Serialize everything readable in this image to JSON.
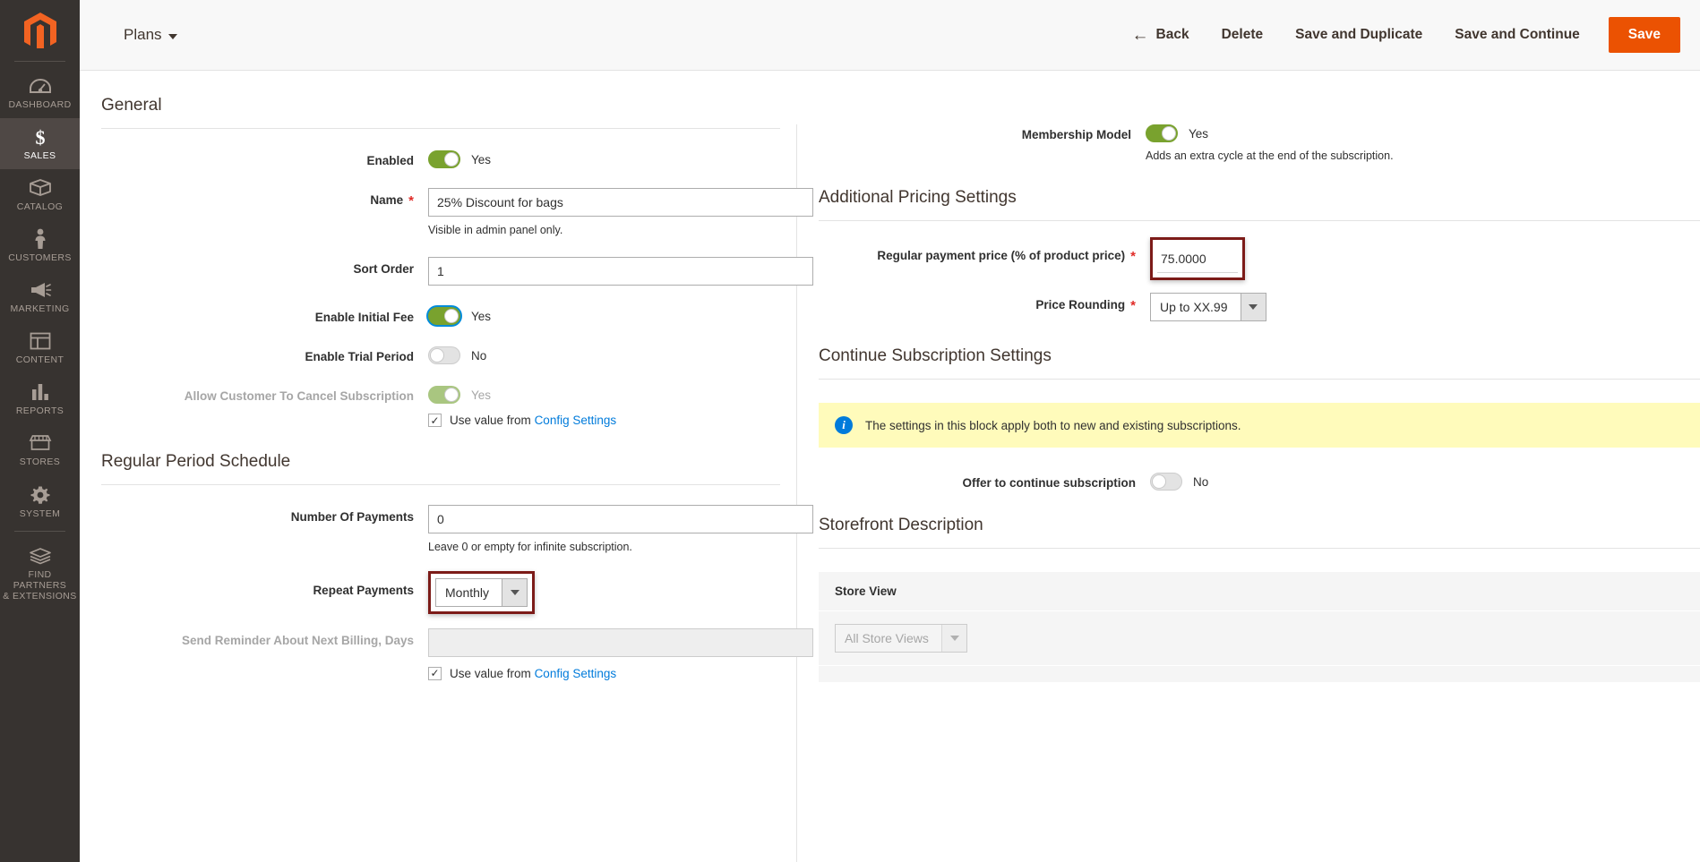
{
  "sidebar": {
    "logo_name": "magento-logo",
    "items": [
      {
        "label": "DASHBOARD",
        "icon": "dashboard-icon",
        "active": false
      },
      {
        "label": "SALES",
        "icon": "dollar-icon",
        "active": true
      },
      {
        "label": "CATALOG",
        "icon": "box-icon",
        "active": false
      },
      {
        "label": "CUSTOMERS",
        "icon": "person-icon",
        "active": false
      },
      {
        "label": "MARKETING",
        "icon": "megaphone-icon",
        "active": false
      },
      {
        "label": "CONTENT",
        "icon": "layout-icon",
        "active": false
      },
      {
        "label": "REPORTS",
        "icon": "bar-chart-icon",
        "active": false
      },
      {
        "label": "STORES",
        "icon": "storefront-icon",
        "active": false
      },
      {
        "label": "SYSTEM",
        "icon": "gear-icon",
        "active": false
      },
      {
        "label": "FIND PARTNERS\n& EXTENSIONS",
        "icon": "puzzle-icon",
        "active": false
      }
    ]
  },
  "header": {
    "breadcrumb": "Plans",
    "back": "Back",
    "delete": "Delete",
    "save_and_duplicate": "Save and Duplicate",
    "save_and_continue": "Save and Continue",
    "save": "Save",
    "accent_color": "#eb5202"
  },
  "left": {
    "general_title": "General",
    "enabled": {
      "label": "Enabled",
      "state": "Yes"
    },
    "name": {
      "label": "Name",
      "value": "25% Discount for bags",
      "hint": "Visible in admin panel only.",
      "required": true
    },
    "sort_order": {
      "label": "Sort Order",
      "value": "1"
    },
    "enable_initial_fee": {
      "label": "Enable Initial Fee",
      "state": "Yes"
    },
    "enable_trial_period": {
      "label": "Enable Trial Period",
      "state": "No"
    },
    "allow_cancel": {
      "label": "Allow Customer To Cancel Subscription",
      "state": "Yes",
      "use_value_prefix": "Use value from",
      "use_value_link": "Config Settings"
    },
    "regular_period_title": "Regular Period Schedule",
    "number_of_payments": {
      "label": "Number Of Payments",
      "value": "0",
      "hint": "Leave 0 or empty for infinite subscription."
    },
    "repeat_payments": {
      "label": "Repeat Payments",
      "value": "Monthly",
      "highlighted": true
    },
    "send_reminder": {
      "label": "Send Reminder About Next Billing, Days",
      "value": "",
      "use_value_prefix": "Use value from",
      "use_value_link": "Config Settings"
    }
  },
  "right": {
    "membership_model": {
      "label": "Membership Model",
      "state": "Yes",
      "hint": "Adds an extra cycle at the end of the subscription."
    },
    "additional_pricing_title": "Additional Pricing Settings",
    "regular_payment_price": {
      "label": "Regular payment price (% of product price)",
      "value": "75.0000",
      "required": true,
      "highlighted": true
    },
    "price_rounding": {
      "label": "Price Rounding",
      "value": "Up to XX.99",
      "required": true
    },
    "continue_subscription_title": "Continue Subscription Settings",
    "notice": "The settings in this block apply both to new and existing subscriptions.",
    "offer_to_continue": {
      "label": "Offer to continue subscription",
      "state": "No"
    },
    "storefront_title": "Storefront Description",
    "store_view_header": "Store View",
    "store_view_value": "All Store Views"
  },
  "colors": {
    "toggle_on": "#79a22e",
    "highlight_border": "#7c1b18",
    "link": "#007bdb",
    "notice_bg": "#fffbbb"
  }
}
